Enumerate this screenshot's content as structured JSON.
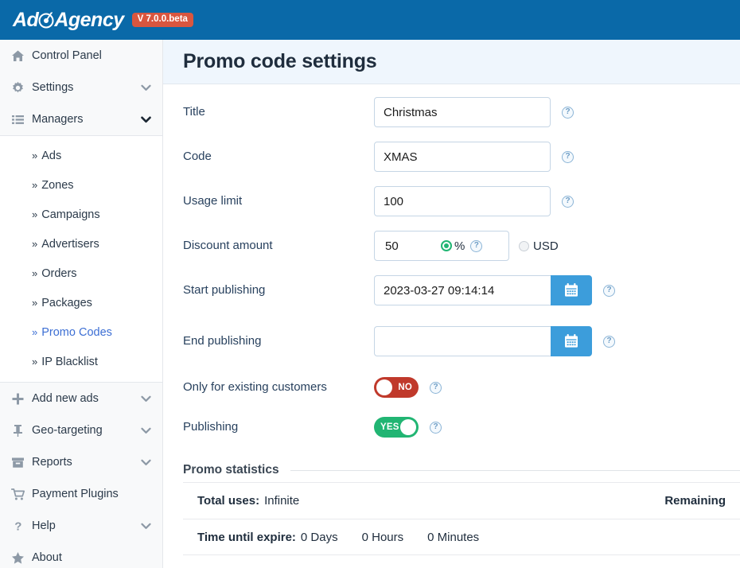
{
  "topbar": {
    "logo_prefix": "Ad",
    "logo_suffix": "Agency",
    "logo_icon": "target-dart-icon",
    "version": "V 7.0.0.beta"
  },
  "sidebar": {
    "items": [
      {
        "label": "Control Panel",
        "icon": "home-icon",
        "chevron": false
      },
      {
        "label": "Settings",
        "icon": "gear-icon",
        "chevron": true
      },
      {
        "label": "Managers",
        "icon": "list-icon",
        "chevron": true,
        "expanded": true
      }
    ],
    "submenu": [
      {
        "label": "Ads",
        "active": false
      },
      {
        "label": "Zones",
        "active": false
      },
      {
        "label": "Campaigns",
        "active": false
      },
      {
        "label": "Advertisers",
        "active": false
      },
      {
        "label": "Orders",
        "active": false
      },
      {
        "label": "Packages",
        "active": false
      },
      {
        "label": "Promo Codes",
        "active": true
      },
      {
        "label": "IP Blacklist",
        "active": false
      }
    ],
    "items_bottom": [
      {
        "label": "Add new ads",
        "icon": "plus-icon",
        "chevron": true
      },
      {
        "label": "Geo-targeting",
        "icon": "pin-icon",
        "chevron": true
      },
      {
        "label": "Reports",
        "icon": "archive-icon",
        "chevron": true
      },
      {
        "label": "Payment Plugins",
        "icon": "cart-icon",
        "chevron": false
      },
      {
        "label": "Help",
        "icon": "question-icon",
        "chevron": true
      },
      {
        "label": "About",
        "icon": "star-icon",
        "chevron": false
      }
    ],
    "submenu_chevron": "»"
  },
  "header": {
    "title": "Promo code settings"
  },
  "form": {
    "title": {
      "label": "Title",
      "value": "Christmas",
      "placeholder": ""
    },
    "code": {
      "label": "Code",
      "value": "XMAS",
      "placeholder": ""
    },
    "usage_limit": {
      "label": "Usage limit",
      "value": "100",
      "placeholder": ""
    },
    "discount": {
      "label": "Discount amount",
      "value": "50",
      "placeholder": "",
      "unit_percent": "%",
      "unit_usd": "USD",
      "selected_unit": "%"
    },
    "start_publishing": {
      "label": "Start publishing",
      "value": "2023-03-27 09:14:14",
      "placeholder": "",
      "calendar_icon": "calendar-icon"
    },
    "end_publishing": {
      "label": "End publishing",
      "value": "",
      "placeholder": "",
      "calendar_icon": "calendar-icon"
    },
    "existing_customers": {
      "label": "Only for existing customers",
      "state": "NO",
      "on": false
    },
    "publishing": {
      "label": "Publishing",
      "state": "YES",
      "on": true
    },
    "help_glyph": "?"
  },
  "stats": {
    "legend": "Promo statistics",
    "rows": [
      {
        "key": "Total uses:",
        "value": "Infinite",
        "extras": [],
        "right": "Remaining"
      },
      {
        "key": "Time until expire:",
        "value": "0 Days",
        "extras": [
          "0 Hours",
          "0 Minutes"
        ],
        "right": ""
      }
    ]
  },
  "colors": {
    "topbar": "#0a69a8",
    "badge": "#d9563f",
    "accent_blue": "#3c9ddb",
    "active_link": "#3d6fd4",
    "toggle_on": "#21b573",
    "toggle_off": "#c0392b",
    "header_bg": "#eff6fd"
  }
}
